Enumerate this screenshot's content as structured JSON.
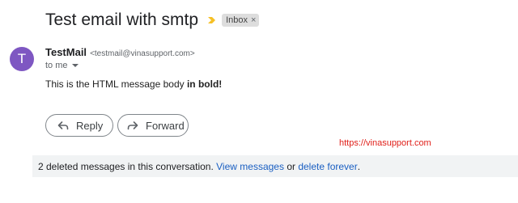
{
  "thread": {
    "subject": "Test email with smtp",
    "label": "Inbox",
    "label_remove": "×"
  },
  "message": {
    "avatar_letter": "T",
    "sender_name": "TestMail",
    "sender_email": "<testmail@vinasupport.com>",
    "recipient_text": "to me",
    "body_text": "This is the HTML message body ",
    "body_bold": "in bold!"
  },
  "actions": {
    "reply_label": "Reply",
    "forward_label": "Forward"
  },
  "watermark": "https://vinasupport.com",
  "deleted_notice": {
    "text": "2 deleted messages in this conversation.",
    "view_link": "View messages",
    "conjunction": "or",
    "delete_link": "delete forever",
    "end": "."
  },
  "colors": {
    "avatar_bg": "#7e57c2",
    "importance_marker": "#f6c026",
    "link": "#1a5fc2",
    "watermark": "#e0201a",
    "notice_bg": "#f1f3f4"
  },
  "icons": {
    "importance": "importance-marker-icon",
    "reply": "reply-arrow-icon",
    "forward": "forward-arrow-icon",
    "recipient_dropdown": "caret-down-icon"
  }
}
